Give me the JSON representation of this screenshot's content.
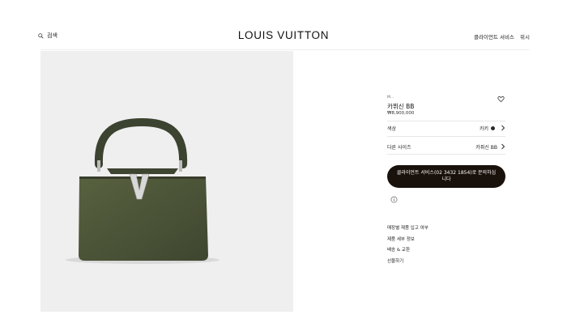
{
  "header": {
    "search_label": "검색",
    "logo": "LOUIS VUITTON",
    "client_service": "클라이언트 서비스",
    "wishlist": "위시"
  },
  "product": {
    "sku": "M...",
    "name": "카퓌신 BB",
    "price": "₩8,900,000",
    "color_label": "색상",
    "color_value": "카키",
    "other_sizes_label": "다른 사이즈",
    "other_sizes_value": "카퓌신 BB",
    "cta": "클라이언트 서비스(02 3432 1854)로 문의하십니다"
  },
  "links": [
    "매장별 재품 입고 여부",
    "제품 세부 정보",
    "배송 & 교환",
    "선물하기"
  ],
  "colors": {
    "bag": "#4a5236",
    "cta_bg": "#19110b",
    "image_bg": "#efefef"
  }
}
